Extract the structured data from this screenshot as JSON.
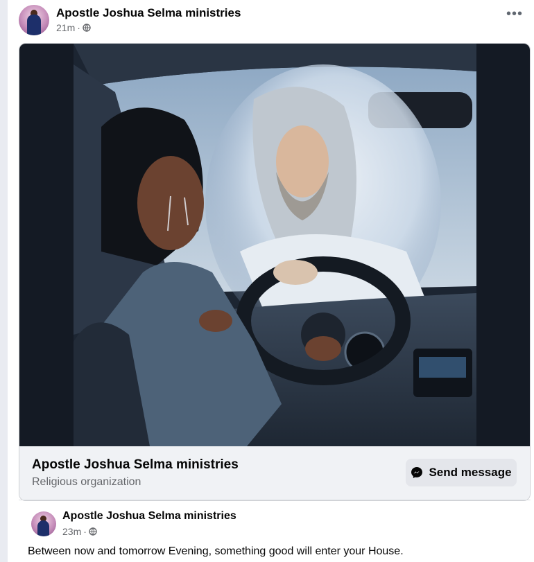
{
  "post": {
    "author": "Apostle Joshua Selma ministries",
    "time": "21m",
    "separator": "·",
    "audience_icon": "globe-icon",
    "more_icon": "more-options-icon"
  },
  "shared_card": {
    "image_description": "AI-generated painting: crying woman driving a car while a glowing Jesus figure steadies the steering wheel",
    "page_name": "Apostle Joshua Selma ministries",
    "page_category": "Religious organization",
    "send_message_label": "Send message",
    "send_icon": "messenger-icon"
  },
  "nested_post": {
    "author": "Apostle Joshua Selma ministries",
    "time": "23m",
    "separator": "·",
    "caption": "Between now and tomorrow Evening, something good will enter your House."
  },
  "colors": {
    "secondary_text": "#65676b",
    "button_bg": "#e4e6eb",
    "card_bg": "#f0f2f5"
  }
}
